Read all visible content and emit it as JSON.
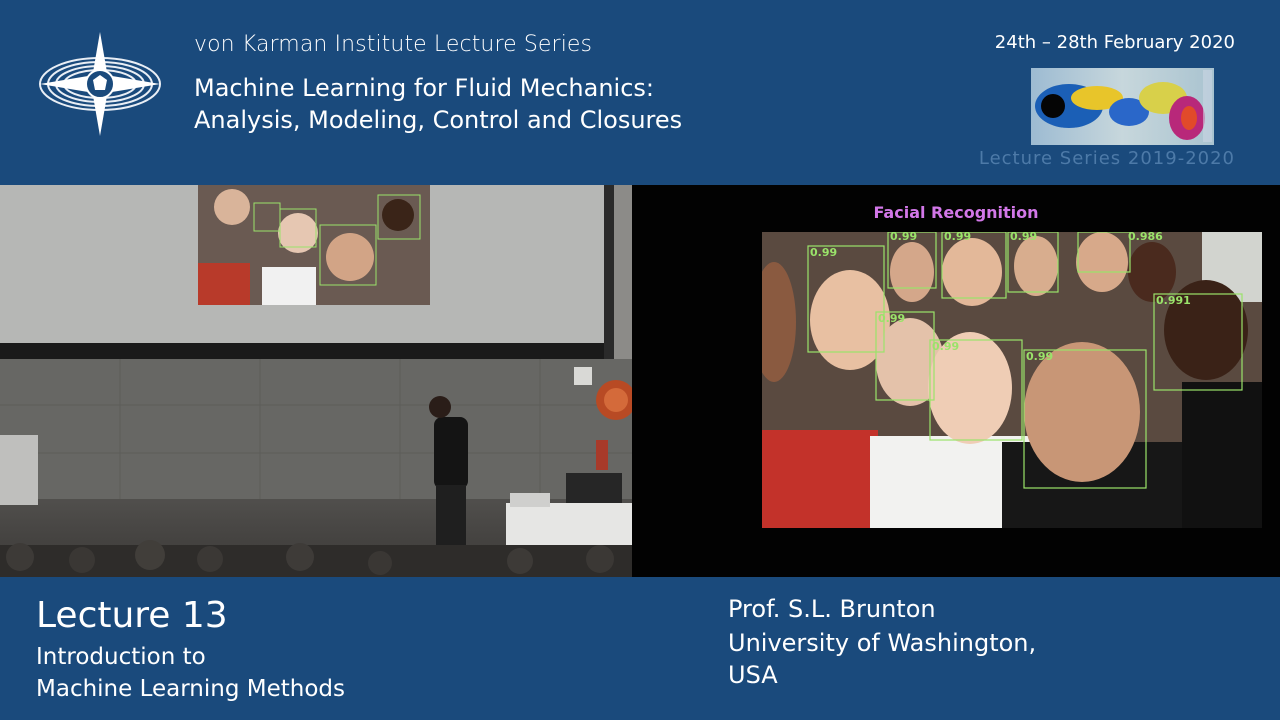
{
  "header": {
    "series_title": "von Karman Institute Lecture Series",
    "course_title_line1": "Machine Learning for Fluid Mechanics:",
    "course_title_line2": "Analysis, Modeling, Control and Closures",
    "dates": "24th – 28th February 2020",
    "series_year": "Lecture Series 2019-2020",
    "logo_icon": "vki-compass-logo-icon"
  },
  "slide": {
    "title": "Facial Recognition",
    "detection_scores": [
      "0.99",
      "0.99",
      "0.99",
      "0.986",
      "0.99",
      "0.991",
      "0.99",
      "0.99",
      "0.99"
    ]
  },
  "footer": {
    "lecture_number": "Lecture 13",
    "topic_line1": "Introduction to",
    "topic_line2": "Machine Learning Methods",
    "speaker": "Prof. S.L. Brunton",
    "affiliation_line1": "University of Washington,",
    "affiliation_line2": "USA"
  },
  "colors": {
    "banner_blue": "#1a4a7c",
    "detection_box_green": "#9ae36a",
    "slide_title_purple": "#d277e8"
  }
}
